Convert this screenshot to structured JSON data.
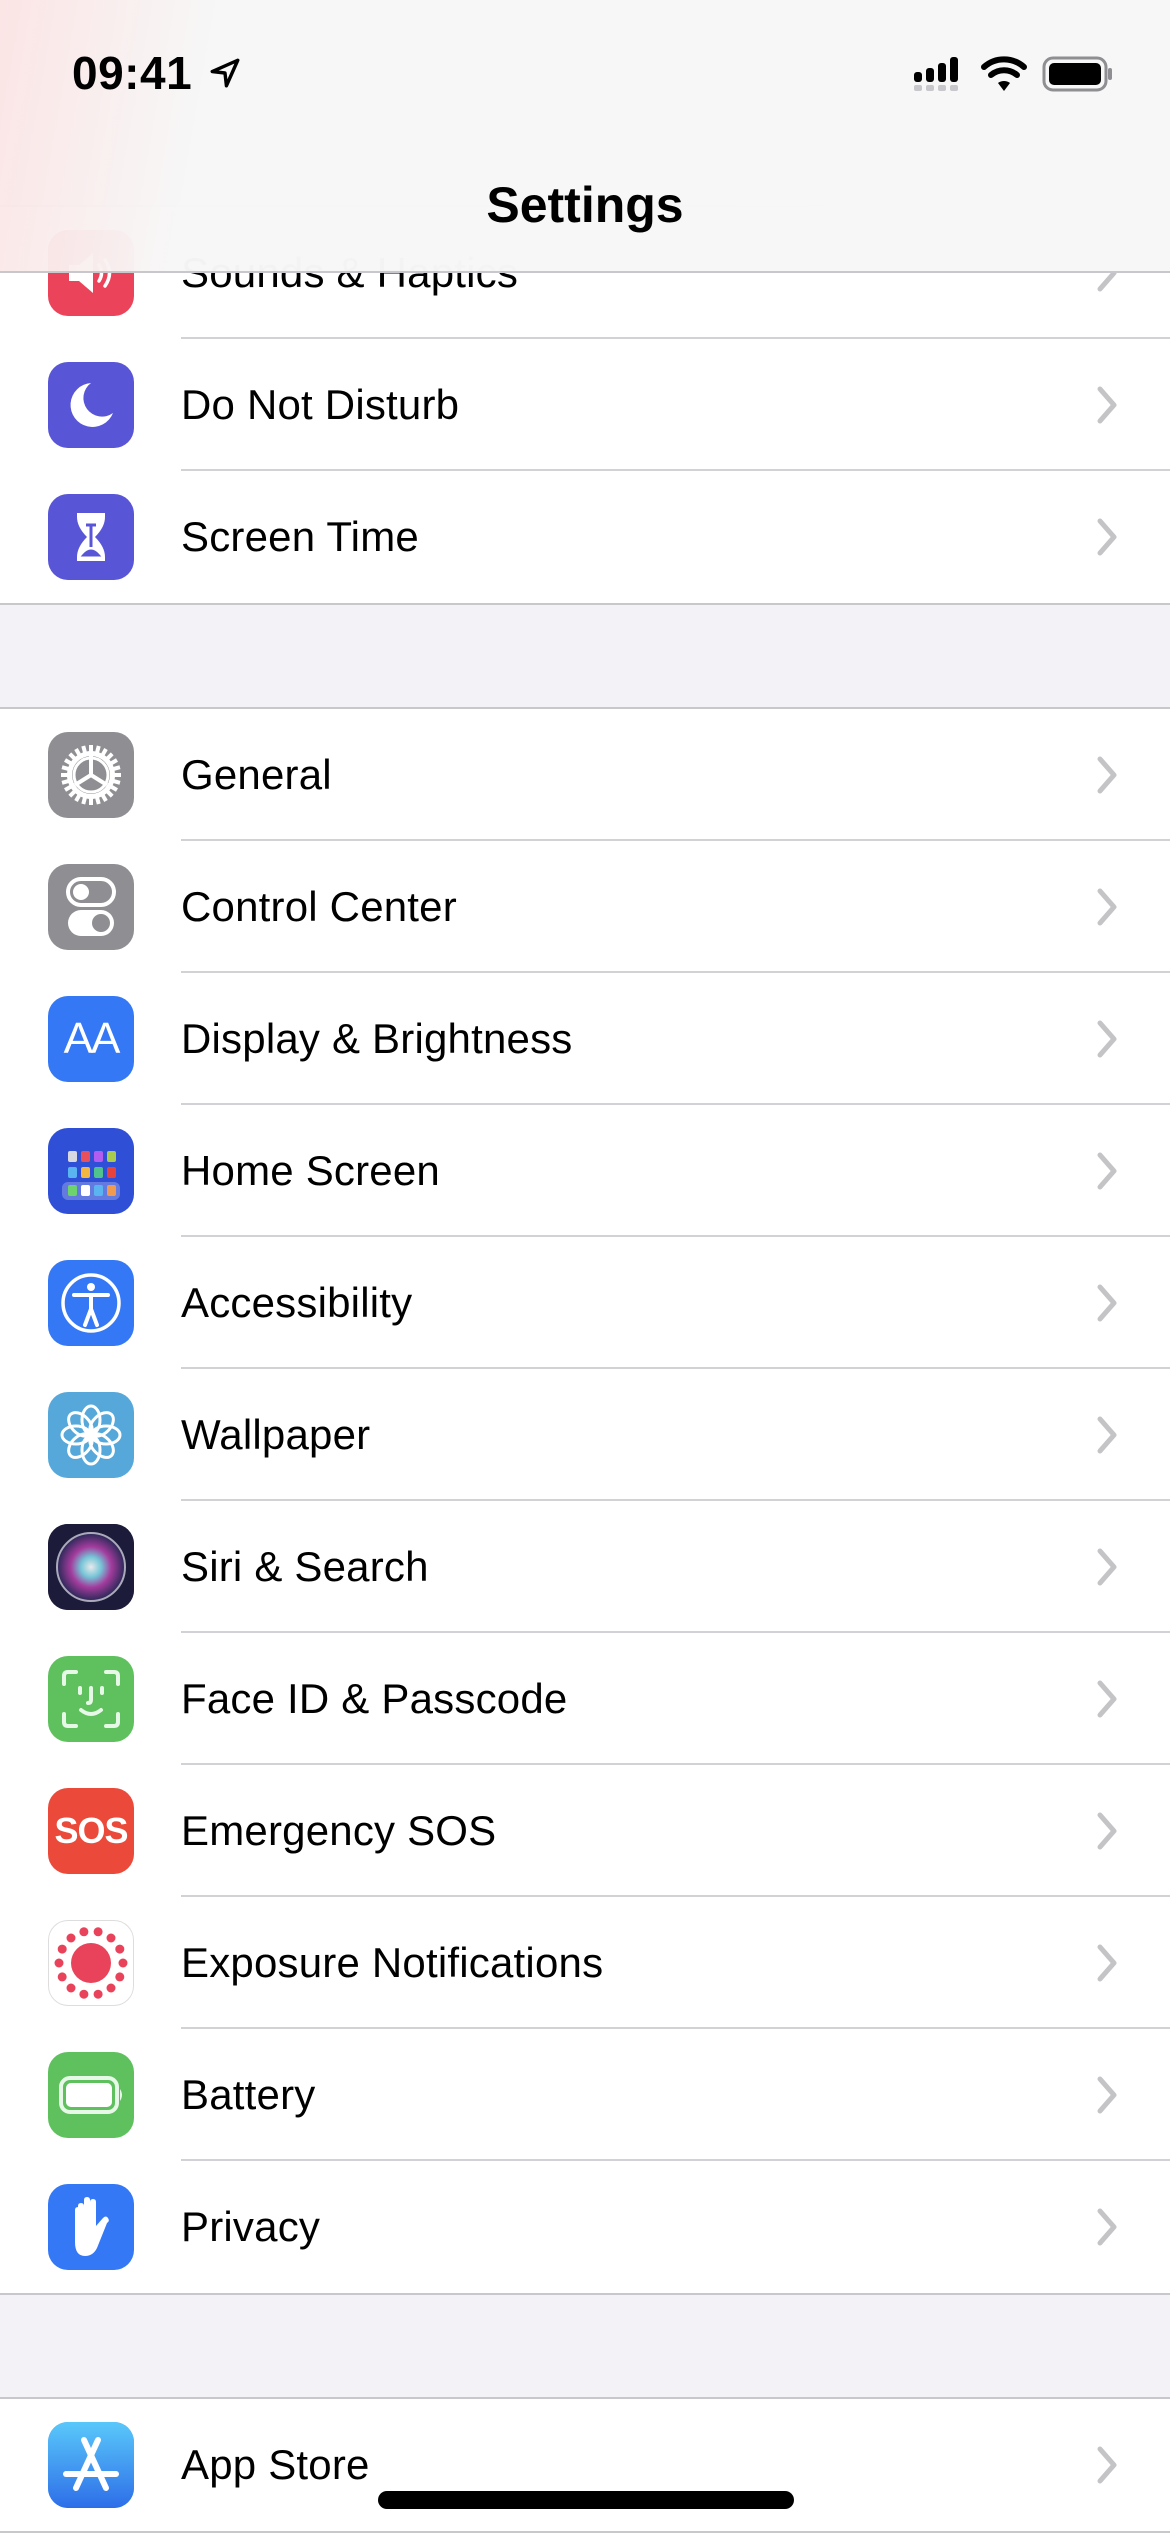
{
  "status_bar": {
    "time": "09:41",
    "location_icon": "location-arrow-icon",
    "signal_icon": "cellular-signal-icon",
    "wifi_icon": "wifi-icon",
    "battery_icon": "battery-full-icon"
  },
  "nav": {
    "title": "Settings"
  },
  "groups": [
    {
      "items": [
        {
          "label": "Sounds & Haptics",
          "icon": "speaker-icon",
          "color": "#eb445a"
        },
        {
          "label": "Do Not Disturb",
          "icon": "moon-icon",
          "color": "#5856d6"
        },
        {
          "label": "Screen Time",
          "icon": "hourglass-icon",
          "color": "#5856d6"
        }
      ]
    },
    {
      "items": [
        {
          "label": "General",
          "icon": "gear-icon",
          "color": "#8e8e93"
        },
        {
          "label": "Control Center",
          "icon": "toggles-icon",
          "color": "#8e8e93"
        },
        {
          "label": "Display & Brightness",
          "icon": "text-size-icon",
          "color": "#3478f6",
          "glyph": "AA"
        },
        {
          "label": "Home Screen",
          "icon": "app-grid-icon",
          "color": "#2f4fd6"
        },
        {
          "label": "Accessibility",
          "icon": "accessibility-icon",
          "color": "#3478f6"
        },
        {
          "label": "Wallpaper",
          "icon": "flower-icon",
          "color": "#55a8d9"
        },
        {
          "label": "Siri & Search",
          "icon": "siri-icon",
          "color": "#1c1c3a"
        },
        {
          "label": "Face ID & Passcode",
          "icon": "face-id-icon",
          "color": "#5ec15e"
        },
        {
          "label": "Emergency SOS",
          "icon": "sos-icon",
          "color": "#eb4a3a",
          "glyph": "SOS"
        },
        {
          "label": "Exposure Notifications",
          "icon": "exposure-icon",
          "color": "#ffffff"
        },
        {
          "label": "Battery",
          "icon": "battery-icon",
          "color": "#5ec15e"
        },
        {
          "label": "Privacy",
          "icon": "hand-icon",
          "color": "#3478f6"
        }
      ]
    },
    {
      "items": [
        {
          "label": "App Store",
          "icon": "app-store-icon",
          "color": "#3a8cf0"
        }
      ]
    }
  ]
}
